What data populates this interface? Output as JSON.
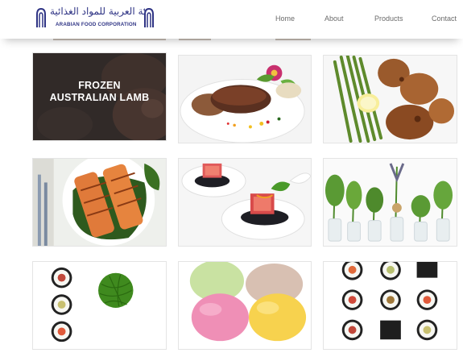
{
  "brand": {
    "arabic_name": "الشركة العربية للمواد الغذائية",
    "english_name": "ARABIAN FOOD CORPORATION",
    "primary_color": "#2e3384"
  },
  "nav": {
    "items": [
      {
        "label": "Home"
      },
      {
        "label": "About"
      },
      {
        "label": "Products"
      },
      {
        "label": "Contact"
      }
    ]
  },
  "gallery": {
    "tiles": [
      {
        "title": "FROZEN AUSTRALIAN LAMB",
        "icon": "lamb-chops-image"
      },
      {
        "icon": "seared-foie-gras-image"
      },
      {
        "icon": "chicken-asparagus-image"
      },
      {
        "icon": "grilled-salmon-image"
      },
      {
        "icon": "tuna-caviar-spoons-image"
      },
      {
        "icon": "herbs-in-vases-image"
      },
      {
        "icon": "sushi-seaweed-salad-image"
      },
      {
        "icon": "mochi-image"
      },
      {
        "icon": "sushi-rolls-image"
      }
    ]
  }
}
